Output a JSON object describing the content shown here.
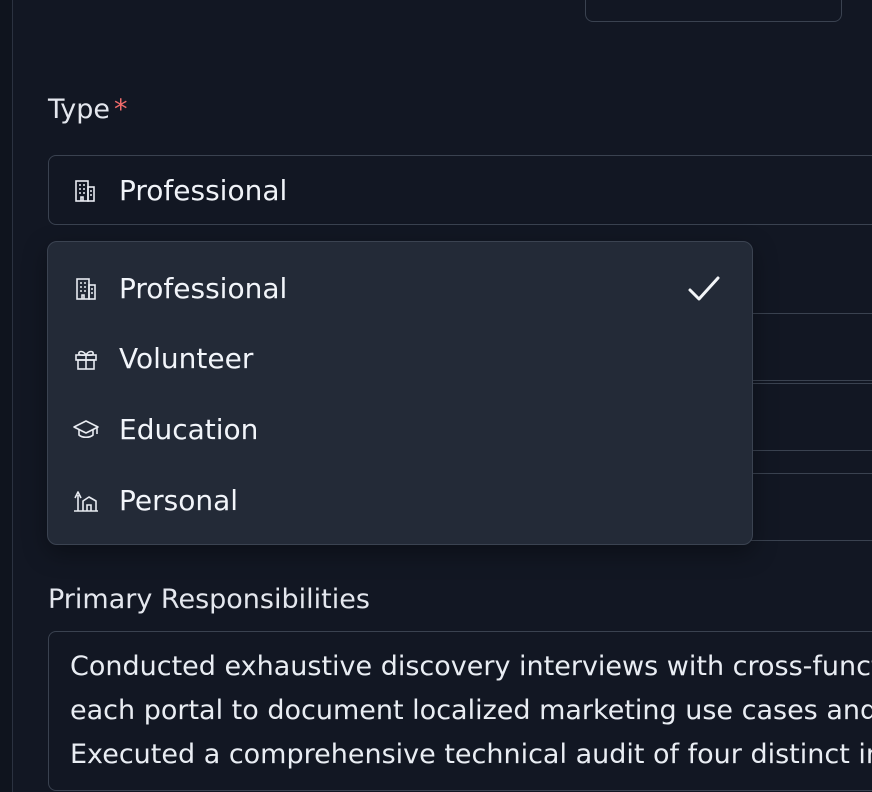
{
  "form": {
    "type_field": {
      "label": "Type",
      "required_marker": "*",
      "selected_value": "Professional",
      "selected_icon": "building-icon"
    },
    "dropdown": {
      "options": [
        {
          "label": "Professional",
          "icon": "building-icon",
          "selected": true
        },
        {
          "label": "Volunteer",
          "icon": "gift-icon",
          "selected": false
        },
        {
          "label": "Education",
          "icon": "graduation-cap-icon",
          "selected": false
        },
        {
          "label": "Personal",
          "icon": "home-tree-icon",
          "selected": false
        }
      ]
    },
    "responsibilities_field": {
      "label": "Primary Responsibilities",
      "lines": [
        "Conducted exhaustive discovery interviews with cross-funct",
        "each portal to document localized marketing use cases and",
        "Executed a comprehensive technical audit of four distinct in"
      ]
    }
  },
  "colors": {
    "background": "#121723",
    "dropdown_background": "#232a37",
    "border": "#3a4250",
    "required": "#f06b6b",
    "text": "#eef1f6"
  }
}
